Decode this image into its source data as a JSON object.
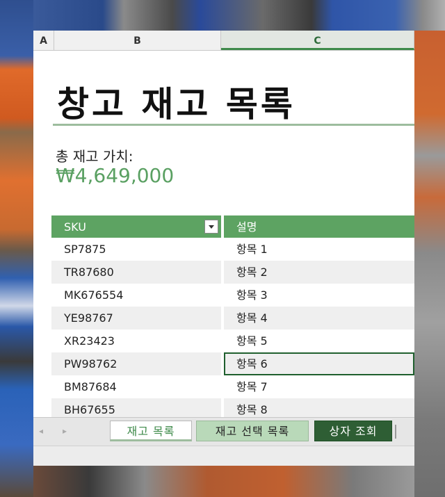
{
  "columns": {
    "a": "A",
    "b": "B",
    "c": "C"
  },
  "title": "창고 재고 목록",
  "total": {
    "label": "총 재고 가치:",
    "value": "₩4,649,000"
  },
  "table": {
    "headers": {
      "sku": "SKU",
      "description": "설명"
    },
    "rows": [
      {
        "sku": "SP7875",
        "description": "항목 1"
      },
      {
        "sku": "TR87680",
        "description": "항목 2"
      },
      {
        "sku": "MK676554",
        "description": "항목 3"
      },
      {
        "sku": "YE98767",
        "description": "항목 4"
      },
      {
        "sku": "XR23423",
        "description": "항목 5"
      },
      {
        "sku": "PW98762",
        "description": "항목 6"
      },
      {
        "sku": "BM87684",
        "description": "항목 7"
      },
      {
        "sku": "BH67655",
        "description": "항목 8"
      }
    ]
  },
  "tabs": [
    {
      "label": "재고 목록"
    },
    {
      "label": "재고 선택 목록"
    },
    {
      "label": "상자 조회"
    }
  ],
  "nav": {
    "prev": "◂",
    "next": "▸"
  },
  "colors": {
    "accent": "#5da362",
    "dark_tab": "#2e5e34",
    "value_text": "#5aa062"
  }
}
